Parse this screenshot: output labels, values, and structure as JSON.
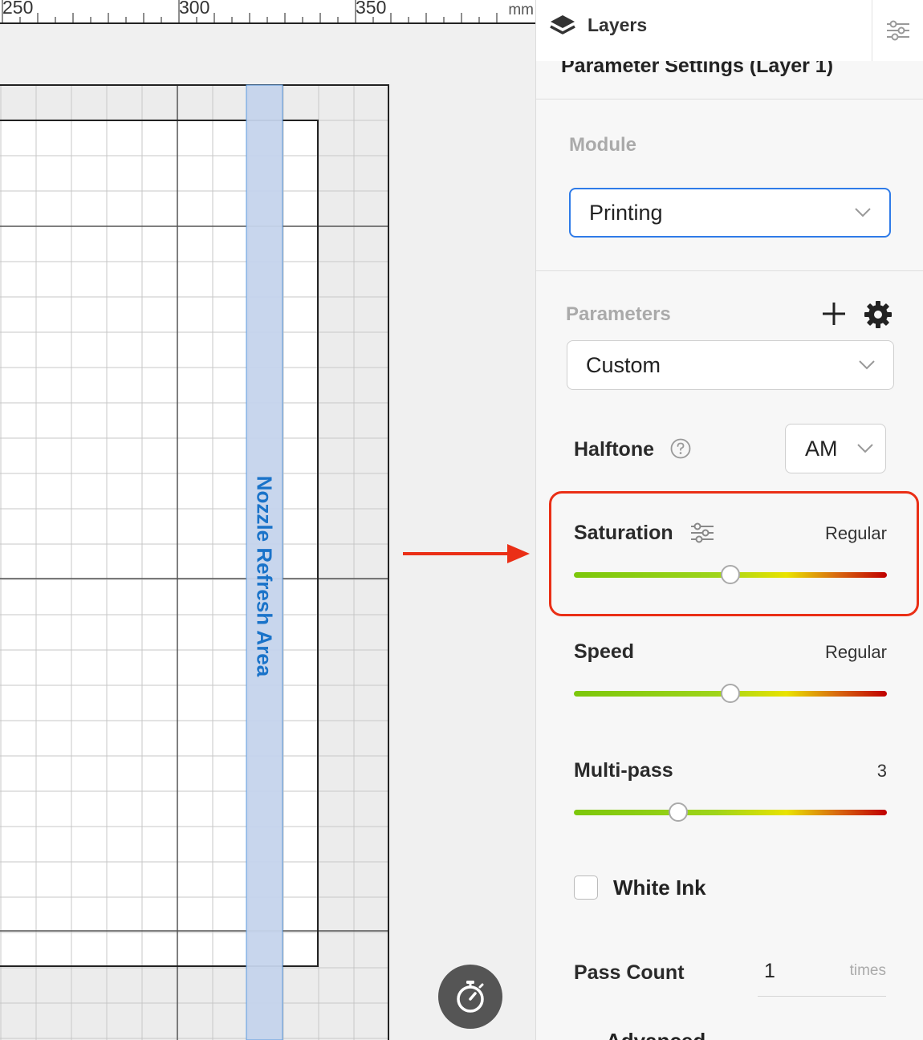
{
  "ruler": {
    "labels": [
      "250",
      "300",
      "350"
    ],
    "unit": "mm"
  },
  "canvas": {
    "nozzle_area_label": "Nozzle Refresh Area",
    "colors": {
      "nozzle_fill": "#c5d4ec",
      "nozzle_text": "#1a73c9",
      "arrow": "#ea2f16",
      "grid_minor": "#c7c7c7",
      "grid_major": "#555555"
    },
    "timer_icon": "stopwatch-icon"
  },
  "panel": {
    "layers_title": "Layers",
    "layers_icon": "layers-icon",
    "settings_icon": "sliders-icon",
    "section_title": "Parameter Settings (Layer 1)",
    "module": {
      "label": "Module",
      "value": "Printing"
    },
    "parameters": {
      "label": "Parameters",
      "value": "Custom",
      "add_icon": "plus-icon",
      "gear_icon": "gear-icon"
    },
    "halftone": {
      "label": "Halftone",
      "value": "AM",
      "help_icon": "question-circle-icon"
    },
    "saturation": {
      "label": "Saturation",
      "value": "Regular",
      "level": 0.5,
      "icon": "sliders-icon",
      "highlight_color": "#ea2f16"
    },
    "speed": {
      "label": "Speed",
      "value": "Regular",
      "level": 0.5
    },
    "multipass": {
      "label": "Multi-pass",
      "value": "3",
      "level": 0.333
    },
    "white_ink": {
      "label": "White Ink",
      "checked": false
    },
    "pass_count": {
      "label": "Pass Count",
      "value": "1",
      "unit": "times"
    },
    "advanced": {
      "label": "Advanced"
    },
    "accent_color": "#2f7be8"
  }
}
